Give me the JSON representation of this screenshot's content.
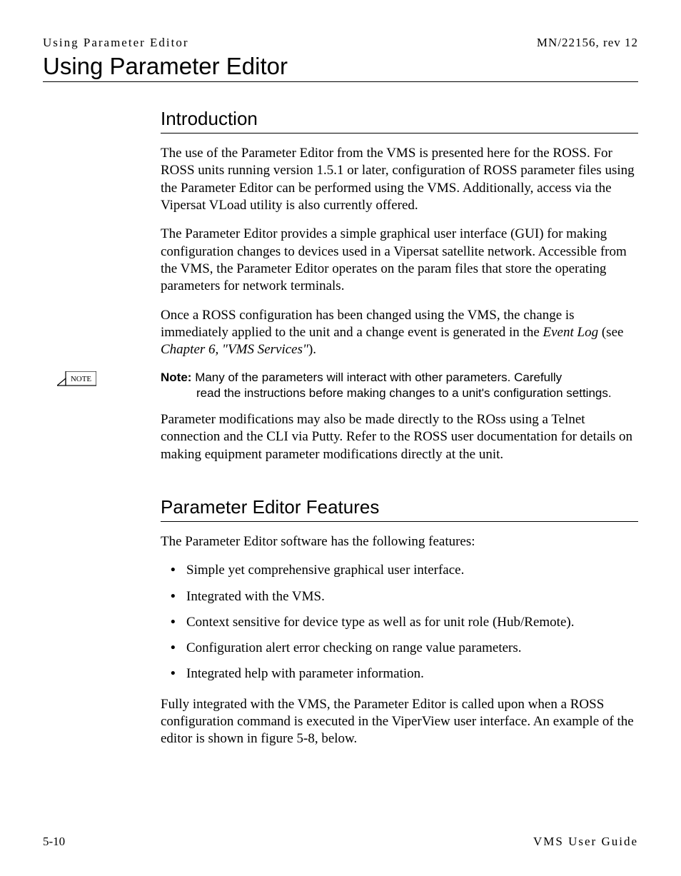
{
  "header": {
    "left": "Using Parameter Editor",
    "right": "MN/22156, rev 12"
  },
  "chapter_title": "Using Parameter Editor",
  "intro": {
    "title": "Introduction",
    "p1": "The use of the Parameter Editor from the VMS is presented here for the ROSS. For ROSS units running version 1.5.1 or later, configuration of ROSS parameter files using the Parameter Editor can be performed using the VMS. Additionally, access via the Vipersat VLoad utility is also currently offered.",
    "p2": "The Parameter Editor provides a simple graphical user interface (GUI) for making configuration changes to devices used in a Vipersat satellite network. Accessible from the VMS, the Parameter Editor operates on the param files that store the operating parameters for network terminals.",
    "p3_prefix": "Once a ROSS configuration has been changed using the VMS, the change is immediately applied to the unit and a change event is generated in the ",
    "p3_em1": "Event Log",
    "p3_mid": " (see ",
    "p3_em2": "Chapter 6, \"VMS Services\"",
    "p3_suffix": ").",
    "note_label": "Note:",
    "note_icon_label": "NOTE",
    "note_first": "Many of the parameters will interact with other parameters. Carefully ",
    "note_rest": "read the instructions before making changes to a unit's configuration settings.",
    "p4": "Parameter modifications may also be made directly to the ROss using a Telnet connection and the CLI via Putty. Refer to the ROSS user documentation for details on making equipment parameter modifications directly at the unit."
  },
  "features": {
    "title": "Parameter Editor Features",
    "lead": "The Parameter Editor software has the following features:",
    "items": [
      "Simple yet comprehensive graphical user interface.",
      "Integrated with the VMS.",
      "Context sensitive for device type as well as for unit role (Hub/Remote).",
      "Configuration alert error checking on range value parameters.",
      "Integrated help with parameter information."
    ],
    "closing": "Fully integrated with the VMS, the Parameter Editor is called upon when a ROSS configuration command is executed in the ViperView user interface. An example of the editor is shown in figure 5-8, below."
  },
  "footer": {
    "left": "5-10",
    "right": "VMS User Guide"
  }
}
